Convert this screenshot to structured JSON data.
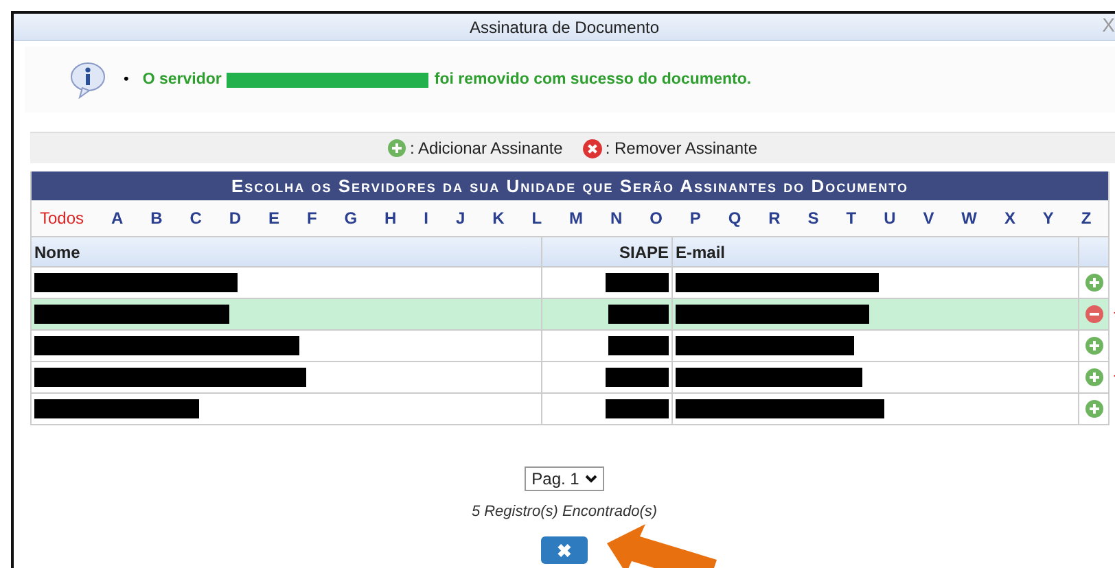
{
  "window": {
    "title": "Assinatura de Documento",
    "close": "X"
  },
  "message": {
    "bullet": "•",
    "before": "O servidor",
    "after": "foi removido com sucesso do documento."
  },
  "legend": [
    {
      "kind": "add",
      "label": ": Adicionar Assinante"
    },
    {
      "kind": "remove",
      "label": ": Remover Assinante"
    }
  ],
  "table": {
    "title": "Escolha os Servidores da sua Unidade que Serão Assinantes do Documento",
    "letters": [
      {
        "label": "Todos",
        "selected": true
      },
      {
        "label": "A",
        "selected": false
      },
      {
        "label": "B",
        "selected": false
      },
      {
        "label": "C",
        "selected": false
      },
      {
        "label": "D",
        "selected": false
      },
      {
        "label": "E",
        "selected": false
      },
      {
        "label": "F",
        "selected": false
      },
      {
        "label": "G",
        "selected": false
      },
      {
        "label": "H",
        "selected": false
      },
      {
        "label": "I",
        "selected": false
      },
      {
        "label": "J",
        "selected": false
      },
      {
        "label": "K",
        "selected": false
      },
      {
        "label": "L",
        "selected": false
      },
      {
        "label": "M",
        "selected": false
      },
      {
        "label": "N",
        "selected": false
      },
      {
        "label": "O",
        "selected": false
      },
      {
        "label": "P",
        "selected": false
      },
      {
        "label": "Q",
        "selected": false
      },
      {
        "label": "R",
        "selected": false
      },
      {
        "label": "S",
        "selected": false
      },
      {
        "label": "T",
        "selected": false
      },
      {
        "label": "U",
        "selected": false
      },
      {
        "label": "V",
        "selected": false
      },
      {
        "label": "W",
        "selected": false
      },
      {
        "label": "X",
        "selected": false
      },
      {
        "label": "Y",
        "selected": false
      },
      {
        "label": "Z",
        "selected": false
      }
    ],
    "columns": [
      "Nome",
      "SIAPE",
      "E-mail"
    ],
    "rows": [
      {
        "selected": false,
        "kind": "add",
        "annotated": false
      },
      {
        "selected": true,
        "kind": "remove",
        "annotated": true
      },
      {
        "selected": false,
        "kind": "add",
        "annotated": false
      },
      {
        "selected": false,
        "kind": "add",
        "annotated": true
      },
      {
        "selected": false,
        "kind": "add",
        "annotated": false
      }
    ]
  },
  "pager": {
    "value": "Pag. 1"
  },
  "records": "5 Registro(s) Encontrado(s)",
  "close_button": {
    "label": "✖"
  }
}
